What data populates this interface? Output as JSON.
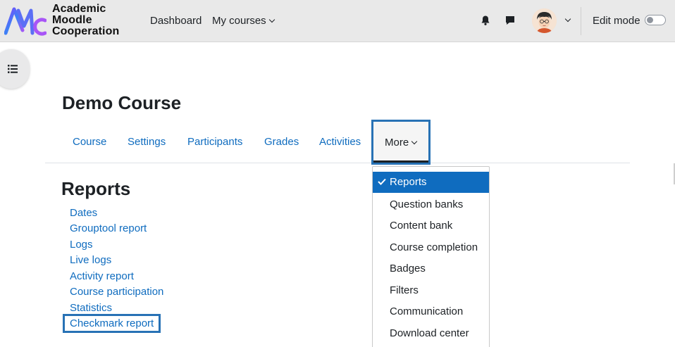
{
  "brand": {
    "line1": "Academic",
    "line2": "Moodle",
    "line3": "Cooperation"
  },
  "nav": {
    "dashboard": "Dashboard",
    "my_courses": "My courses"
  },
  "user": {
    "edit_mode_label": "Edit mode"
  },
  "icons": {
    "notifications": "bell-icon",
    "messages": "chat-icon",
    "drawer": "list-icon",
    "checkmark": "check-icon"
  },
  "course": {
    "title": "Demo Course"
  },
  "tabs": [
    {
      "label": "Course"
    },
    {
      "label": "Settings"
    },
    {
      "label": "Participants"
    },
    {
      "label": "Grades"
    },
    {
      "label": "Activities"
    },
    {
      "label": "More"
    }
  ],
  "more_menu": {
    "items": [
      {
        "label": "Reports",
        "active": true
      },
      {
        "label": "Question banks"
      },
      {
        "label": "Content bank"
      },
      {
        "label": "Course completion"
      },
      {
        "label": "Badges"
      },
      {
        "label": "Filters"
      },
      {
        "label": "Communication"
      },
      {
        "label": "Download center"
      }
    ]
  },
  "reports": {
    "heading": "Reports",
    "links": [
      {
        "label": "Dates"
      },
      {
        "label": "Grouptool report"
      },
      {
        "label": "Logs"
      },
      {
        "label": "Live logs"
      },
      {
        "label": "Activity report"
      },
      {
        "label": "Course participation"
      },
      {
        "label": "Statistics"
      },
      {
        "label": "Checkmark report"
      }
    ]
  },
  "colors": {
    "accent": "#0f6cbf",
    "highlight_border": "#2872b5",
    "navbar": "#e9e9e9"
  }
}
